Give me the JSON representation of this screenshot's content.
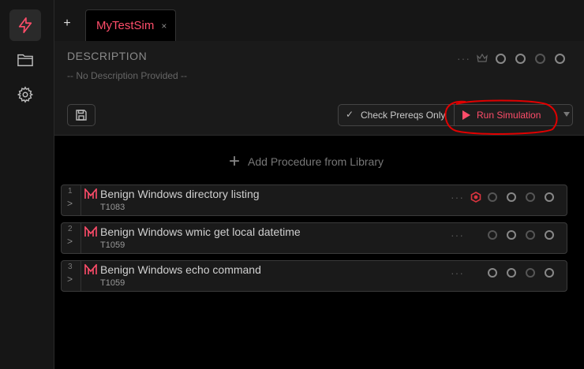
{
  "sidebar": {
    "accent": "#ff4d6a",
    "items": [
      {
        "icon": "lightning-icon",
        "active": true
      },
      {
        "icon": "folder-icon",
        "active": false
      },
      {
        "icon": "gear-icon",
        "active": false
      }
    ]
  },
  "tabs": {
    "add_label": "+",
    "active": {
      "label": "MyTestSim",
      "close": "×"
    }
  },
  "header": {
    "description_title": "DESCRIPTION",
    "description_text": "-- No Description Provided --",
    "actions_icon": "dots-icon",
    "prereq_label": "Check Prereqs Only",
    "run_label": "Run Simulation"
  },
  "add_procedure": {
    "label": "Add Procedure from Library"
  },
  "procedures": [
    {
      "number": "1",
      "name": "Benign Windows directory listing",
      "id": "T1083"
    },
    {
      "number": "2",
      "name": "Benign Windows wmic get local datetime",
      "id": "T1059"
    },
    {
      "number": "3",
      "name": "Benign Windows echo command",
      "id": "T1059"
    }
  ]
}
